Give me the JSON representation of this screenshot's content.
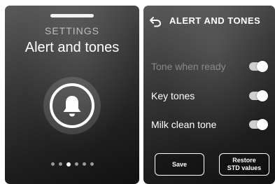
{
  "left": {
    "section_label": "SETTINGS",
    "title": "Alert and tones",
    "icon": "bell-icon",
    "pager": {
      "count": 6,
      "active_index": 2
    }
  },
  "right": {
    "back_icon": "back-arrow-icon",
    "header_title": "ALERT AND TONES",
    "settings": [
      {
        "label": "Tone when ready",
        "enabled": true
      },
      {
        "label": "Key tones",
        "enabled": true
      },
      {
        "label": "Milk clean tone",
        "enabled": true
      }
    ],
    "buttons": {
      "save_label": "Save",
      "restore_label": "Restore\nSTD values"
    }
  },
  "colors": {
    "background_dark": "#1a1a1a",
    "text": "#ffffff",
    "dim_text": "#8a8a8a",
    "toggle_on": "#cfcfcf"
  }
}
